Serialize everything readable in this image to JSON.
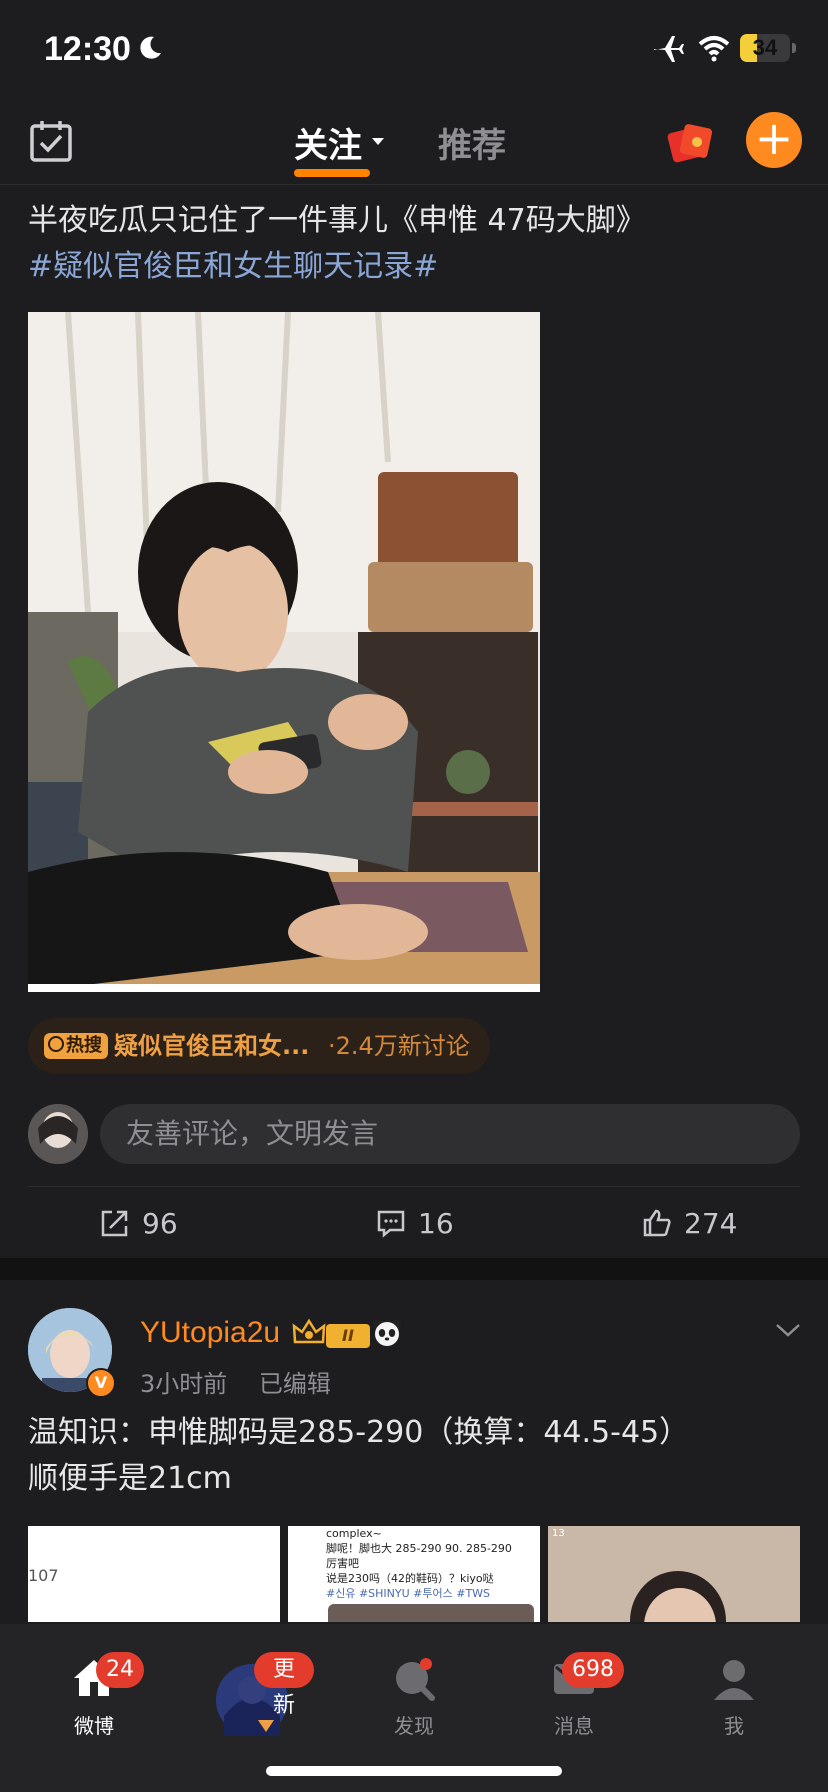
{
  "status_bar": {
    "time": "12:30",
    "battery": "34",
    "battery_level_percent": 34,
    "icons": [
      "moon-icon",
      "airplane-icon",
      "wifi-icon",
      "battery-icon"
    ]
  },
  "top_nav": {
    "tabs": [
      {
        "label": "关注",
        "active": true
      },
      {
        "label": "推荐",
        "active": false
      }
    ],
    "left_icon": "calendar-check-icon",
    "right_icons": [
      "red-packet-icon",
      "add-icon"
    ],
    "add_label": "+"
  },
  "post1": {
    "text": "半夜吃瓜只记住了一件事儿《申惟 47码大脚》",
    "hashtag": "#疑似官俊臣和女生聊天记录#",
    "hot_search": {
      "badge": "热搜",
      "title": "疑似官俊臣和女...",
      "count": "·2.4万新讨论"
    },
    "comment_placeholder": "友善评论，文明发言",
    "actions": {
      "repost": "96",
      "comment": "16",
      "like": "274"
    }
  },
  "post2": {
    "username": "YUtopia2u",
    "level": "II",
    "verified_badge": "V",
    "time": "3小时前",
    "edited": "已编辑",
    "text_line1": "温知识：申惟脚码是285-290（换算：44.5-45）",
    "text_line2": "顺便手是21cm",
    "thumb1_text": "107",
    "thumb2_lines": [
      "complex~",
      "脚呢！脚也大 285-290 90. 285-290",
      "厉害吧",
      "说是230吗（42的鞋码）？kiyo哒",
      "#신유 #SHINYU #투어스 #TWS"
    ],
    "thumb3_text": "13"
  },
  "tab_bar": {
    "items": [
      {
        "label": "微博",
        "badge": "24",
        "icon": "home-icon",
        "active": true
      },
      {
        "label": "更新",
        "badge": "更新",
        "icon": "avatar-icon",
        "active": false
      },
      {
        "label": "发现",
        "badge": "",
        "icon": "discover-icon",
        "active": false
      },
      {
        "label": "消息",
        "badge": "698",
        "icon": "message-icon",
        "active": false
      },
      {
        "label": "我",
        "badge": "",
        "icon": "profile-icon",
        "active": false
      }
    ]
  },
  "colors": {
    "background": "#1d1d1f",
    "accent": "#ff8200",
    "hashtag": "#8aa6d6",
    "badge_red": "#e33b2c"
  }
}
